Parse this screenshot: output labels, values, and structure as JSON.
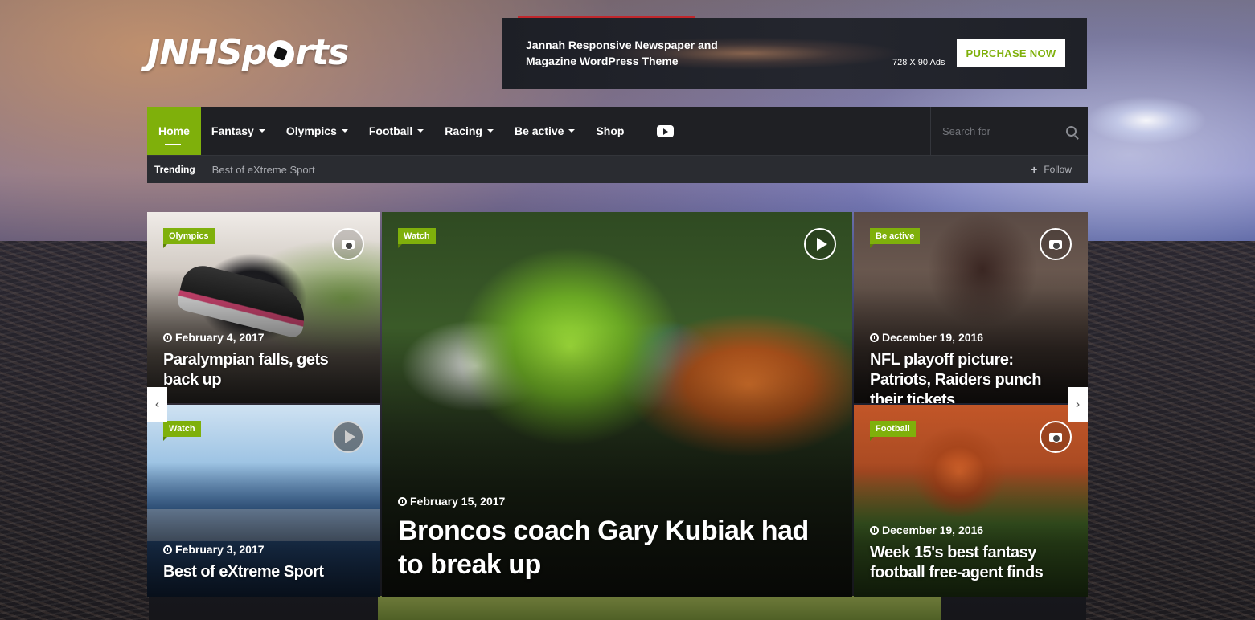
{
  "header": {
    "logo_text_1": "JNHSp",
    "logo_text_2": "rts"
  },
  "ad": {
    "headline": "Jannah Responsive Newspaper and Magazine WordPress Theme",
    "size": "728 X 90 Ads",
    "button": "PURCHASE NOW"
  },
  "nav": {
    "items": [
      {
        "label": "Home",
        "active": true
      },
      {
        "label": "Fantasy",
        "dropdown": true
      },
      {
        "label": "Olympics",
        "dropdown": true
      },
      {
        "label": "Football",
        "dropdown": true
      },
      {
        "label": "Racing",
        "dropdown": true
      },
      {
        "label": "Be active",
        "dropdown": true
      },
      {
        "label": "Shop"
      }
    ],
    "search_placeholder": "Search for",
    "icons": [
      "youtube-icon",
      "search-icon"
    ]
  },
  "trending": {
    "label": "Trending",
    "text": "Best of eXtreme Sport",
    "follow": "Follow"
  },
  "slider": {
    "tiles": [
      {
        "category": "Olympics",
        "date": "February 4, 2017",
        "title": "Paralympian falls, gets back up",
        "icon": "camera-icon"
      },
      {
        "category": "Watch",
        "date": "February 3, 2017",
        "title": "Best of eXtreme Sport",
        "icon": "play-icon"
      },
      {
        "category": "Watch",
        "date": "February 15, 2017",
        "title": "Broncos coach Gary Kubiak had to break up",
        "icon": "play-icon"
      },
      {
        "category": "Be active",
        "date": "December 19, 2016",
        "title": "NFL playoff picture: Patriots, Raiders punch their tickets",
        "icon": "camera-icon"
      },
      {
        "category": "Football",
        "date": "December 19, 2016",
        "title": "Week 15's best fantasy football free-agent finds",
        "icon": "camera-icon"
      }
    ]
  },
  "colors": {
    "accent": "#7fb00b",
    "nav_bg": "#1f2024",
    "trending_bg": "#2a2c31"
  }
}
